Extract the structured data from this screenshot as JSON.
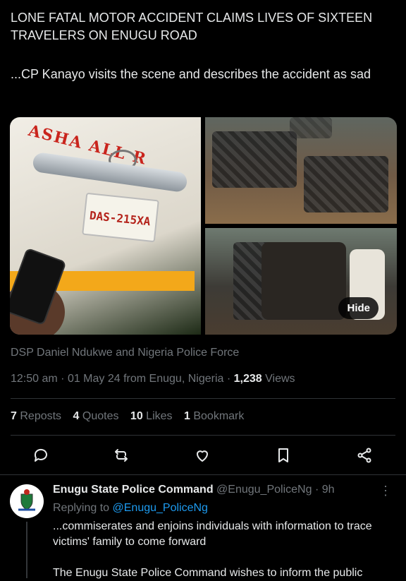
{
  "post": {
    "headline": "LONE FATAL MOTOR ACCIDENT CLAIMS LIVES OF SIXTEEN TRAVELERS ON ENUGU ROAD",
    "subtext": "...CP Kanayo visits the scene and describes the accident as sad",
    "bus_lettering": "ASHA ALL R",
    "plate_text": "DAS-215XA",
    "hide_label": "Hide",
    "credit": "DSP Daniel Ndukwe and Nigeria Police Force",
    "time": "12:50 am",
    "date": "01 May 24",
    "location": "from Enugu, Nigeria",
    "views_count": "1,238",
    "views_label": "Views",
    "stats": {
      "reposts_count": "7",
      "reposts_label": "Reposts",
      "quotes_count": "4",
      "quotes_label": "Quotes",
      "likes_count": "10",
      "likes_label": "Likes",
      "bookmarks_count": "1",
      "bookmarks_label": "Bookmark"
    }
  },
  "actions": {
    "icons": [
      "reply-icon",
      "repost-icon",
      "like-icon",
      "bookmark-icon",
      "share-icon"
    ]
  },
  "reply": {
    "name": "Enugu State Police Command",
    "handle": "@Enugu_PoliceNg",
    "age": "· 9h",
    "replying_prefix": "Replying to",
    "replying_handle": "@Enugu_PoliceNg",
    "text1": "...commiserates and enjoins individuals with information to trace victims' family to come forward",
    "text2": "The Enugu State Police Command wishes to inform the public"
  },
  "colors": {
    "background": "#000000",
    "text": "#e7e9ea",
    "muted": "#71767b",
    "link": "#1d9bf0",
    "divider": "#2f3336"
  }
}
